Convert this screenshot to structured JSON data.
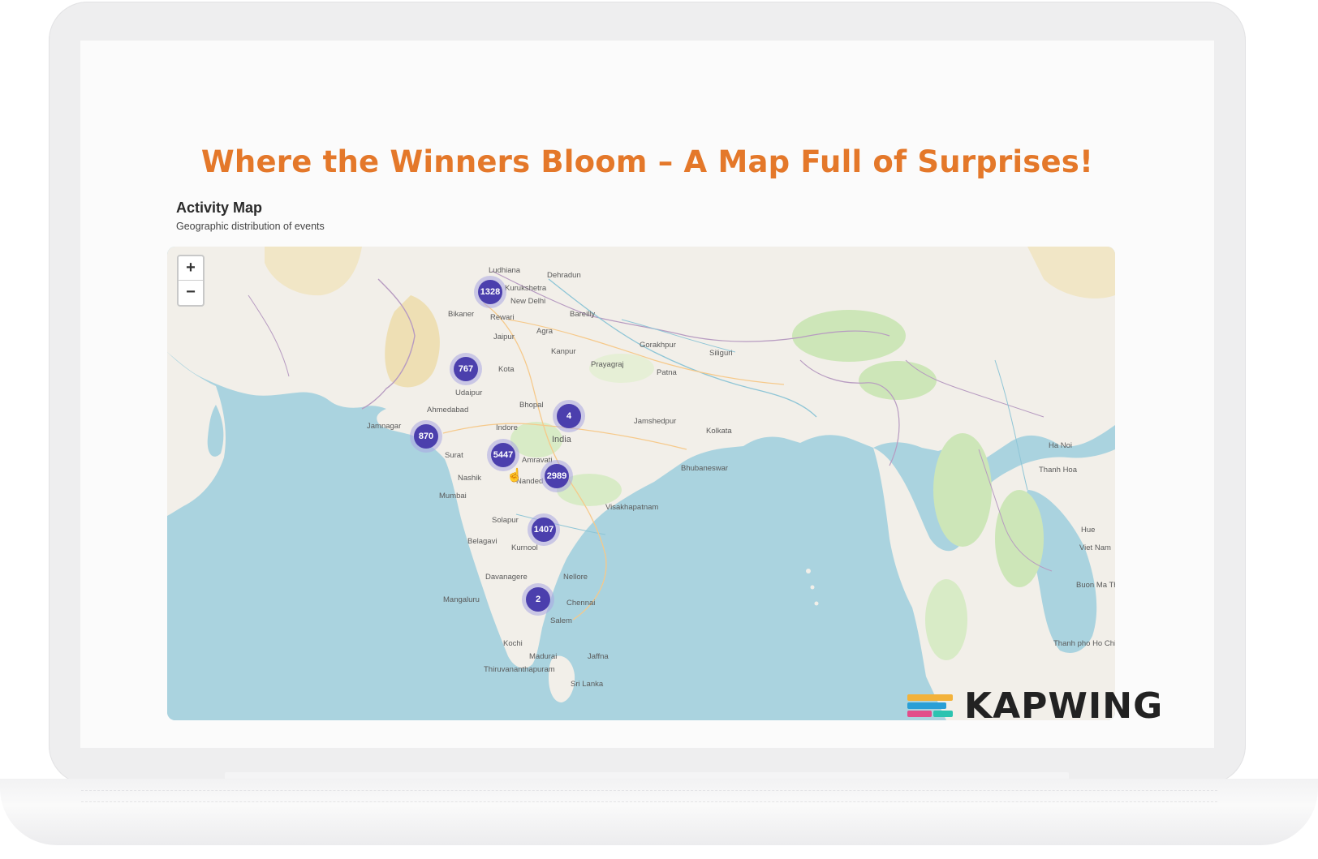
{
  "headline": "Where the Winners Bloom – A Map Full of Surprises!",
  "card": {
    "title": "Activity Map",
    "subtitle": "Geographic distribution of events"
  },
  "zoom": {
    "in_label": "+",
    "out_label": "−"
  },
  "clusters": [
    {
      "label": "1328"
    },
    {
      "label": "767"
    },
    {
      "label": "4"
    },
    {
      "label": "870"
    },
    {
      "label": "5447"
    },
    {
      "label": "2989"
    },
    {
      "label": "1407"
    },
    {
      "label": "2"
    }
  ],
  "places": [
    "Ludhiana",
    "Dehradun",
    "Kurukshetra",
    "New Delhi",
    "Bikaner",
    "Rewari",
    "Bareilly",
    "Jaipur",
    "Agra",
    "Kanpur",
    "Gorakhpur",
    "Siliguri",
    "Kota",
    "Prayagraj",
    "Patna",
    "Udaipur",
    "Ahmedabad",
    "Bhopal",
    "Jamshedpur",
    "Jamnagar",
    "Indore",
    "India",
    "Kolkata",
    "Surat",
    "Amravati",
    "Bhubaneswar",
    "Nashik",
    "Nanded",
    "Mumbai",
    "Visakhapatnam",
    "Solapur",
    "Belagavi",
    "Kurnool",
    "Davanagere",
    "Nellore",
    "Mangaluru",
    "Chennai",
    "Salem",
    "Kochi",
    "Madurai",
    "Thiruvananthapuram",
    "Sri Lanka",
    "Ha Noi",
    "Thanh Hoa",
    "Hue",
    "Viet Nam",
    "Buon Ma Thuot",
    "Thanh pho Ho Chi Minh",
    "Jaffna"
  ],
  "watermark": "KAPWING",
  "colors": {
    "headline": "#e4782a",
    "cluster": "#4b3fad",
    "sea": "#aad3df",
    "land": "#f2efe9",
    "forest": "#cde6b8"
  }
}
